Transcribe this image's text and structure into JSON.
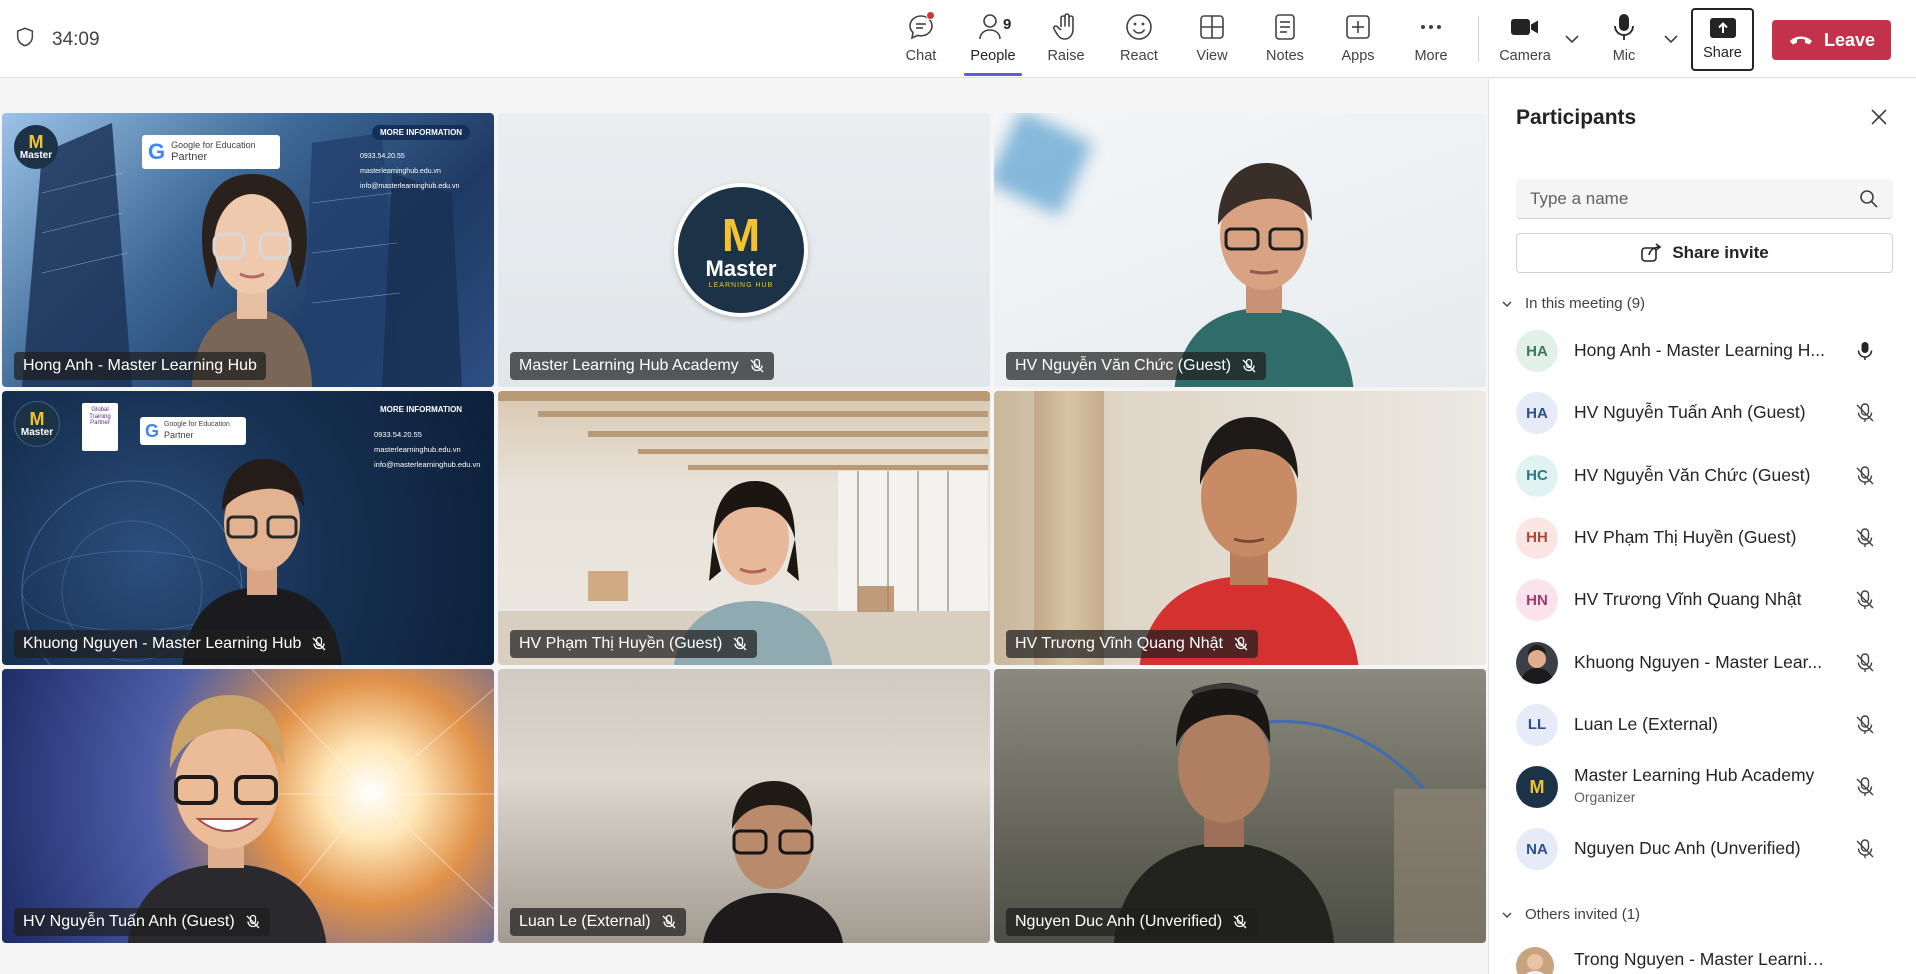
{
  "meeting": {
    "timer": "34:09"
  },
  "toolbar": {
    "chat": "Chat",
    "people": "People",
    "people_count": "9",
    "raise": "Raise",
    "react": "React",
    "view": "View",
    "notes": "Notes",
    "apps": "Apps",
    "more": "More",
    "camera": "Camera",
    "mic": "Mic",
    "share": "Share",
    "leave": "Leave"
  },
  "tiles": [
    {
      "name": "Hong Anh - Master Learning Hub",
      "muted": false
    },
    {
      "name": "Master Learning Hub Academy",
      "muted": true
    },
    {
      "name": "HV Nguyễn Văn Chức (Guest)",
      "muted": true
    },
    {
      "name": "Khuong Nguyen - Master Learning Hub",
      "muted": true
    },
    {
      "name": "HV Phạm Thị Huyền (Guest)",
      "muted": true
    },
    {
      "name": "HV Trương Vĩnh Quang Nhật",
      "muted": true
    },
    {
      "name": "HV Nguyễn Tuấn Anh (Guest)",
      "muted": true
    },
    {
      "name": "Luan Le (External)",
      "muted": true
    },
    {
      "name": "Nguyen Duc Anh (Unverified)",
      "muted": true
    }
  ],
  "branding": {
    "logo_word": "Master",
    "logo_sub": "LEARNING HUB",
    "partner_line1": "Google for Education",
    "partner_line2": "Partner",
    "more_info": "MORE INFORMATION",
    "phone": "0933.54.20.55",
    "site": "masterlearninghub.edu.vn",
    "email": "info@masterlearninghub.edu.vn",
    "badge_text": "Global Training Partner"
  },
  "panel": {
    "title": "Participants",
    "search_placeholder": "Type a name",
    "share_invite": "Share invite",
    "in_meeting": "In this meeting (9)",
    "others_invited": "Others invited (1)",
    "participants": [
      {
        "initials": "HA",
        "name": "Hong Anh - Master Learning H...",
        "role": "",
        "mic": "on",
        "color": "#e3f0e8",
        "fg": "#3b7a57"
      },
      {
        "initials": "HA",
        "name": "HV Nguyễn Tuấn Anh (Guest)",
        "role": "",
        "mic": "off",
        "color": "#e5ecf8",
        "fg": "#2c4e8a"
      },
      {
        "initials": "HC",
        "name": "HV Nguyễn Văn Chức (Guest)",
        "role": "",
        "mic": "off",
        "color": "#e1f2f3",
        "fg": "#2a7a80"
      },
      {
        "initials": "HH",
        "name": "HV Phạm Thị Huyền (Guest)",
        "role": "",
        "mic": "off",
        "color": "#fbe6e3",
        "fg": "#a8493a"
      },
      {
        "initials": "HN",
        "name": "HV Trương Vĩnh Quang Nhật",
        "role": "",
        "mic": "off",
        "color": "#fae3ec",
        "fg": "#a23b6b"
      },
      {
        "initials": "",
        "name": "Khuong Nguyen - Master Lear...",
        "role": "",
        "mic": "off",
        "color": "#3a3f48",
        "fg": "#ffffff"
      },
      {
        "initials": "LL",
        "name": "Luan Le (External)",
        "role": "",
        "mic": "off",
        "color": "#e5ecf8",
        "fg": "#2c4e8a"
      },
      {
        "initials": "M",
        "name": "Master Learning Hub Academy",
        "role": "Organizer",
        "mic": "off",
        "color": "#1c3347",
        "fg": "#f2c230"
      },
      {
        "initials": "NA",
        "name": "Nguyen Duc Anh (Unverified)",
        "role": "",
        "mic": "off",
        "color": "#e5ecf8",
        "fg": "#2c4e8a"
      }
    ],
    "invited": [
      {
        "initials": "",
        "name": "Trong Nguyen - Master Learning ...",
        "color": "#c9a27e"
      }
    ]
  },
  "colors": {
    "accent": "#5b5fc7",
    "leave": "#c4314b",
    "notification": "#d13438"
  }
}
